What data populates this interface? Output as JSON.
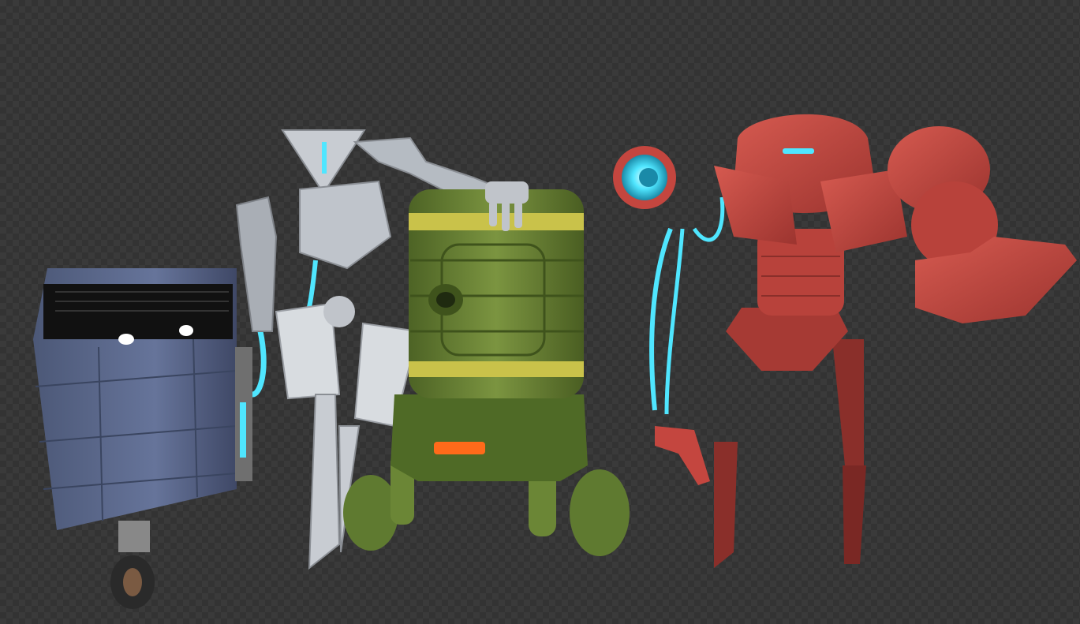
{
  "background": {
    "type": "transparency-checkerboard",
    "colors": [
      "#3a3a3a",
      "#333333"
    ]
  },
  "robots": [
    {
      "name": "box-robot",
      "body_color": "#5b6a8a",
      "eye_color": "#ffffff"
    },
    {
      "name": "skeletal-robot",
      "body_color": "#c8ccd2",
      "glow_color": "#4fe6ff"
    },
    {
      "name": "barrel-robot",
      "body_color": "#6f8a3a",
      "stripe_color": "#c9c24a",
      "light_color": "#ff6a1a"
    },
    {
      "name": "red-armored-robot",
      "body_color": "#c4463f",
      "glow_color": "#4fe6ff"
    }
  ]
}
